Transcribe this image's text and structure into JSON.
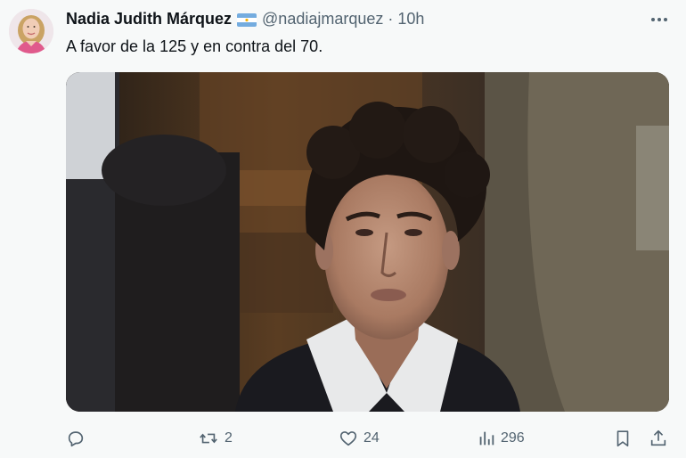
{
  "author": {
    "name": "Nadia Judith Márquez",
    "handle": "@nadiajmarquez",
    "separator": "·",
    "time": "10h"
  },
  "tweet": {
    "text": "A favor de la 125 y en contra del 70."
  },
  "actions": {
    "replies": "",
    "retweets": "2",
    "likes": "24",
    "views": "296"
  },
  "icons": {
    "reply": "reply-icon",
    "retweet": "retweet-icon",
    "like": "heart-icon",
    "views": "views-icon",
    "bookmark": "bookmark-icon",
    "share": "share-icon",
    "more": "more-options-icon",
    "flag": "argentina-flag-icon"
  },
  "colors": {
    "text_primary": "#0f1419",
    "text_secondary": "#536471",
    "background": "#f7f9f9",
    "flag_blue": "#74acdf",
    "flag_white": "#ffffff",
    "flag_sun": "#f6b40e"
  }
}
